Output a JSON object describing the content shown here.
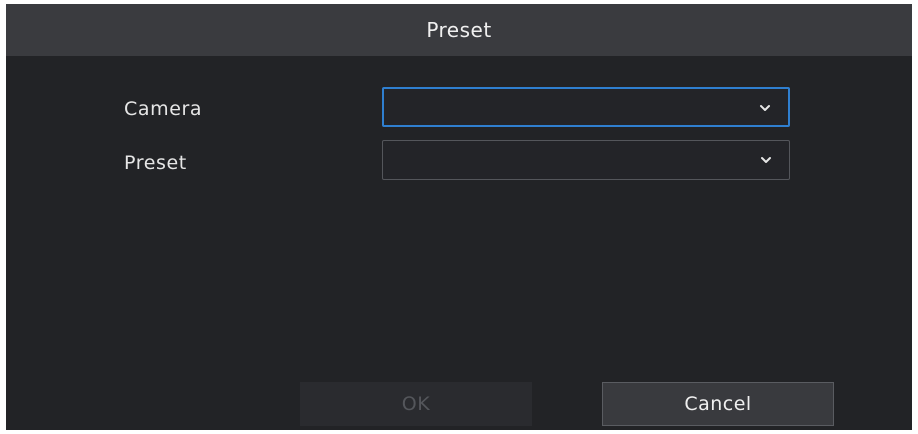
{
  "dialog": {
    "title": "Preset",
    "fields": [
      {
        "label": "Camera",
        "value": "",
        "focused": true
      },
      {
        "label": "Preset",
        "value": "",
        "focused": false
      }
    ],
    "buttons": {
      "ok_label": "OK",
      "ok_enabled": false,
      "cancel_label": "Cancel"
    }
  },
  "icons": {
    "dropdown": "chevron-down-icon"
  },
  "colors": {
    "dialog_background": "#222326",
    "titlebar_background": "#3a3b3f",
    "focus_border": "#2f7fd0",
    "text": "#e6e6e6",
    "disabled_text": "#54565b"
  }
}
